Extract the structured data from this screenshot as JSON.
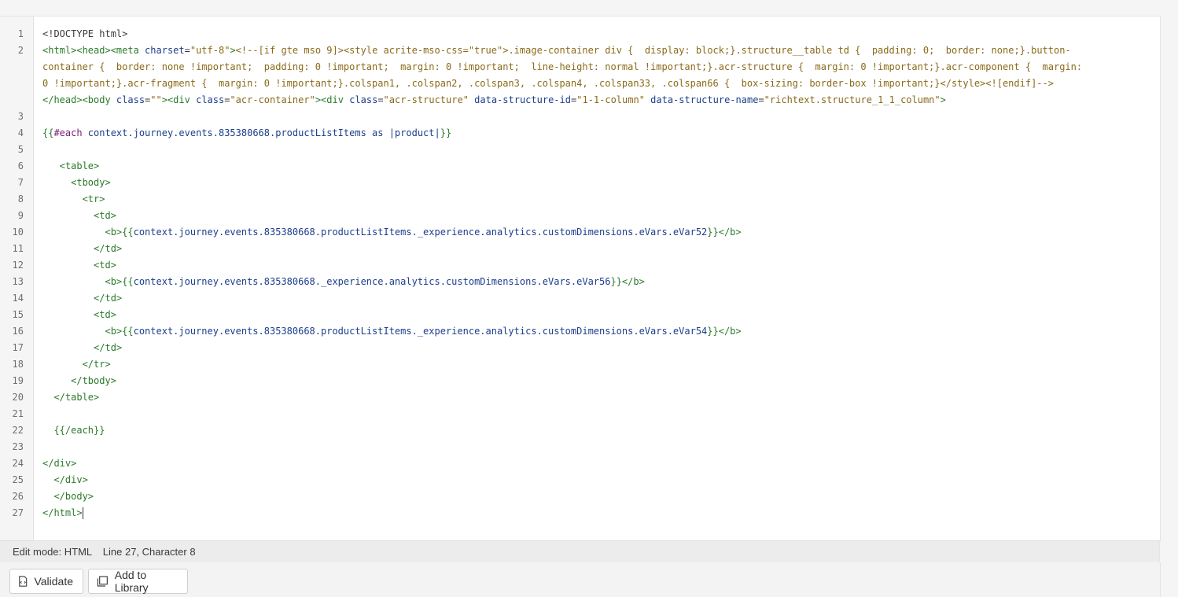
{
  "editor": {
    "lines": [
      {
        "num": "1",
        "segments": [
          {
            "c": "d",
            "v": "<!DOCTYPE html>"
          }
        ]
      },
      {
        "num": "2",
        "segments": [
          {
            "c": "t",
            "v": "<html><head><meta "
          },
          {
            "c": "a",
            "v": "charset"
          },
          {
            "c": "d",
            "v": "="
          },
          {
            "c": "s",
            "v": "\"utf-8\""
          },
          {
            "c": "t",
            "v": ">"
          },
          {
            "c": "s",
            "v": "<!--[if gte mso 9]><style acrite-mso-css=\"true\">.image-container div {  display: block;}.structure__table td {  padding: 0;  border: none;}.button-"
          }
        ]
      },
      {
        "num": "",
        "segments": [
          {
            "c": "s",
            "v": "container {  border: none !important;  padding: 0 !important;  margin: 0 !important;  line-height: normal !important;}.acr-structure {  margin: 0 !important;}.acr-component {  margin:"
          }
        ]
      },
      {
        "num": "",
        "segments": [
          {
            "c": "s",
            "v": "0 !important;}.acr-fragment {  margin: 0 !important;}.colspan1, .colspan2, .colspan3, .colspan4, .colspan33, .colspan66 {  box-sizing: border-box !important;}</style><![endif]-->"
          }
        ]
      },
      {
        "num": "",
        "segments": [
          {
            "c": "t",
            "v": "</head><body "
          },
          {
            "c": "a",
            "v": "class"
          },
          {
            "c": "d",
            "v": "="
          },
          {
            "c": "s",
            "v": "\"\""
          },
          {
            "c": "t",
            "v": "><div "
          },
          {
            "c": "a",
            "v": "class"
          },
          {
            "c": "d",
            "v": "="
          },
          {
            "c": "s",
            "v": "\"acr-container\""
          },
          {
            "c": "t",
            "v": "><div "
          },
          {
            "c": "a",
            "v": "class"
          },
          {
            "c": "d",
            "v": "="
          },
          {
            "c": "s",
            "v": "\"acr-structure\""
          },
          {
            "c": "d",
            "v": " "
          },
          {
            "c": "a",
            "v": "data-structure-id"
          },
          {
            "c": "d",
            "v": "="
          },
          {
            "c": "s",
            "v": "\"1-1-column\""
          },
          {
            "c": "d",
            "v": " "
          },
          {
            "c": "a",
            "v": "data-structure-name"
          },
          {
            "c": "d",
            "v": "="
          },
          {
            "c": "s",
            "v": "\"richtext.structure_1_1_column\""
          },
          {
            "c": "t",
            "v": ">"
          }
        ]
      },
      {
        "num": "3",
        "segments": []
      },
      {
        "num": "4",
        "segments": [
          {
            "c": "t",
            "v": "{{"
          },
          {
            "c": "h",
            "v": "#each"
          },
          {
            "c": "a",
            "v": " context.journey.events.835380668.productListItems as |product|"
          },
          {
            "c": "t",
            "v": "}}"
          }
        ]
      },
      {
        "num": "5",
        "segments": []
      },
      {
        "num": "6",
        "segments": [
          {
            "c": "t",
            "v": "   <table>"
          }
        ]
      },
      {
        "num": "7",
        "segments": [
          {
            "c": "t",
            "v": "     <tbody>"
          }
        ]
      },
      {
        "num": "8",
        "segments": [
          {
            "c": "t",
            "v": "       <tr>"
          }
        ]
      },
      {
        "num": "9",
        "segments": [
          {
            "c": "t",
            "v": "         <td>"
          }
        ]
      },
      {
        "num": "10",
        "segments": [
          {
            "c": "t",
            "v": "           <b>{{"
          },
          {
            "c": "a",
            "v": "context.journey.events.835380668.productListItems._experience.analytics.customDimensions.eVars.eVar52"
          },
          {
            "c": "t",
            "v": "}}</b>"
          }
        ]
      },
      {
        "num": "11",
        "segments": [
          {
            "c": "t",
            "v": "         </td>"
          }
        ]
      },
      {
        "num": "12",
        "segments": [
          {
            "c": "t",
            "v": "         <td>"
          }
        ]
      },
      {
        "num": "13",
        "segments": [
          {
            "c": "t",
            "v": "           <b>{{"
          },
          {
            "c": "a",
            "v": "context.journey.events.835380668._experience.analytics.customDimensions.eVars.eVar56"
          },
          {
            "c": "t",
            "v": "}}</b>"
          }
        ]
      },
      {
        "num": "14",
        "segments": [
          {
            "c": "t",
            "v": "         </td>"
          }
        ]
      },
      {
        "num": "15",
        "segments": [
          {
            "c": "t",
            "v": "         <td>"
          }
        ]
      },
      {
        "num": "16",
        "segments": [
          {
            "c": "t",
            "v": "           <b>{{"
          },
          {
            "c": "a",
            "v": "context.journey.events.835380668.productListItems._experience.analytics.customDimensions.eVars.eVar54"
          },
          {
            "c": "t",
            "v": "}}</b>"
          }
        ]
      },
      {
        "num": "17",
        "segments": [
          {
            "c": "t",
            "v": "         </td>"
          }
        ]
      },
      {
        "num": "18",
        "segments": [
          {
            "c": "t",
            "v": "       </tr>"
          }
        ]
      },
      {
        "num": "19",
        "segments": [
          {
            "c": "t",
            "v": "     </tbody>"
          }
        ]
      },
      {
        "num": "20",
        "segments": [
          {
            "c": "t",
            "v": "  </table>"
          }
        ]
      },
      {
        "num": "21",
        "segments": []
      },
      {
        "num": "22",
        "segments": [
          {
            "c": "t",
            "v": "  {{/each}}"
          }
        ]
      },
      {
        "num": "23",
        "segments": []
      },
      {
        "num": "24",
        "segments": [
          {
            "c": "t",
            "v": "</div>"
          }
        ]
      },
      {
        "num": "25",
        "segments": [
          {
            "c": "t",
            "v": "  </div>"
          }
        ]
      },
      {
        "num": "26",
        "segments": [
          {
            "c": "t",
            "v": "  </body>"
          }
        ]
      },
      {
        "num": "27",
        "segments": [
          {
            "c": "t",
            "v": "</html>"
          }
        ],
        "cursor": true
      }
    ]
  },
  "status": {
    "mode": "Edit mode: HTML",
    "position": "Line 27, Character 8"
  },
  "actions": {
    "validate_label": "Validate",
    "validate_icon": "validate-code-icon",
    "library_label": "Add to Library",
    "library_icon": "library-icon"
  }
}
